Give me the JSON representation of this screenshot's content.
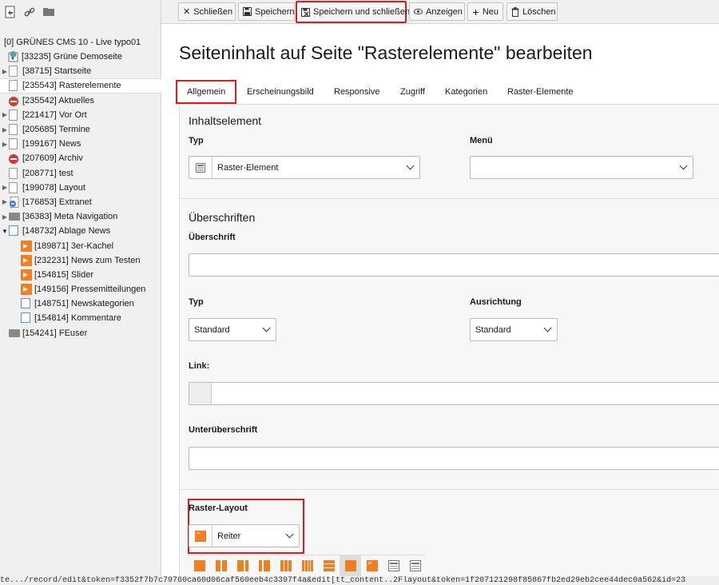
{
  "toolbar": {
    "close": "Schließen",
    "save": "Speichern",
    "save_close": "Speichern und schließen",
    "view": "Anzeigen",
    "new": "Neu",
    "delete": "Löschen"
  },
  "tree": {
    "root": "[0] GRÜNES CMS 10 - Live typo01",
    "nodes": [
      {
        "label": "[33235] Grüne Demoseite",
        "icon": "globe-page"
      },
      {
        "label": "[38715] Startseite",
        "icon": "page"
      },
      {
        "label": "[235543] Rasterelemente",
        "icon": "page"
      },
      {
        "label": "[235542] Aktuelles",
        "icon": "disabled-page"
      },
      {
        "label": "[221417] Vor Ort",
        "icon": "page"
      },
      {
        "label": "[205685] Termine",
        "icon": "page"
      },
      {
        "label": "[199167] News",
        "icon": "page"
      },
      {
        "label": "[207609] Archiv",
        "icon": "disabled-page"
      },
      {
        "label": "[208771] test",
        "icon": "page"
      },
      {
        "label": "[199078] Layout",
        "icon": "page"
      },
      {
        "label": "[176853] Extranet",
        "icon": "extranet"
      },
      {
        "label": "[36383] Meta Navigation",
        "icon": "folder"
      },
      {
        "label": "[148732] Ablage News",
        "icon": "list"
      },
      {
        "label": "[189871] 3er-Kachel",
        "icon": "orange"
      },
      {
        "label": "[232231] News zum Testen",
        "icon": "orange"
      },
      {
        "label": "[154815] Slider",
        "icon": "orange"
      },
      {
        "label": "[149156] Pressemitteilungen",
        "icon": "orange"
      },
      {
        "label": "[148751] Newskategorien",
        "icon": "list"
      },
      {
        "label": "[154814] Kommentare",
        "icon": "list"
      },
      {
        "label": "[154241] FEuser",
        "icon": "folder"
      }
    ]
  },
  "main": {
    "title": "Seiteninhalt auf Seite \"Rasterelemente\" bearbeiten",
    "tabs": [
      "Allgemein",
      "Erscheinungsbild",
      "Responsive",
      "Zugriff",
      "Kategorien",
      "Raster-Elemente"
    ],
    "section_content": "Inhaltselement",
    "typ_label": "Typ",
    "typ_value": "Raster-Element",
    "menu_label": "Menü",
    "section_headers": "Überschriften",
    "header_label": "Überschrift",
    "header_type_label": "Typ",
    "header_type_value": "Standard",
    "align_label": "Ausrichtung",
    "align_value": "Standard",
    "link_label": "Link:",
    "subheader_label": "Unterüberschrift",
    "raster_label": "Raster-Layout",
    "raster_value": "Reiter"
  },
  "status_url": "te.../record/edit&token=f3352f7b7c79760ca60d06caf560eeb4c3397f4a&edit[tt_content..2Flayout&token=1f207121298f85867fb2ed29eb2cee44dec0a562&id=23"
}
